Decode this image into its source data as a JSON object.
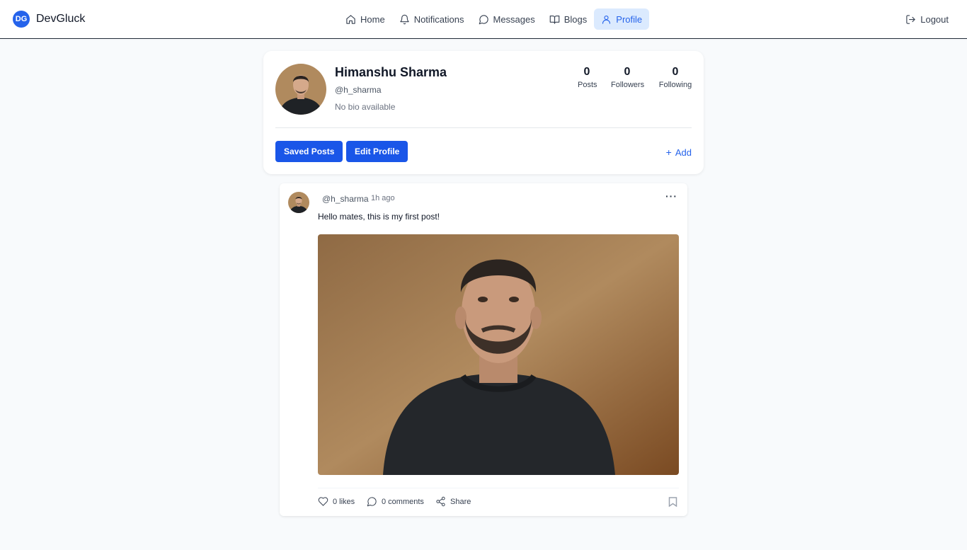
{
  "brand": {
    "logo_text": "DG",
    "name": "DevGluck"
  },
  "nav": {
    "items": [
      {
        "label": "Home",
        "icon": "home-icon"
      },
      {
        "label": "Notifications",
        "icon": "bell-icon"
      },
      {
        "label": "Messages",
        "icon": "message-icon"
      },
      {
        "label": "Blogs",
        "icon": "book-icon"
      },
      {
        "label": "Profile",
        "icon": "user-icon",
        "active": true
      }
    ],
    "logout_label": "Logout"
  },
  "profile": {
    "name": "Himanshu Sharma",
    "handle": "@h_sharma",
    "bio": "No bio available",
    "stats": [
      {
        "value": "0",
        "label": "Posts"
      },
      {
        "value": "0",
        "label": "Followers"
      },
      {
        "value": "0",
        "label": "Following"
      }
    ],
    "saved_posts_label": "Saved Posts",
    "edit_profile_label": "Edit Profile",
    "add_label": "Add"
  },
  "post": {
    "handle": "@h_sharma",
    "time": "1h ago",
    "text": "Hello mates, this is my first post!",
    "likes_label": "0 likes",
    "comments_label": "0 comments",
    "share_label": "Share"
  },
  "colors": {
    "accent": "#2563eb",
    "button": "#1a56e8",
    "active_nav_bg": "#dbeafe"
  }
}
